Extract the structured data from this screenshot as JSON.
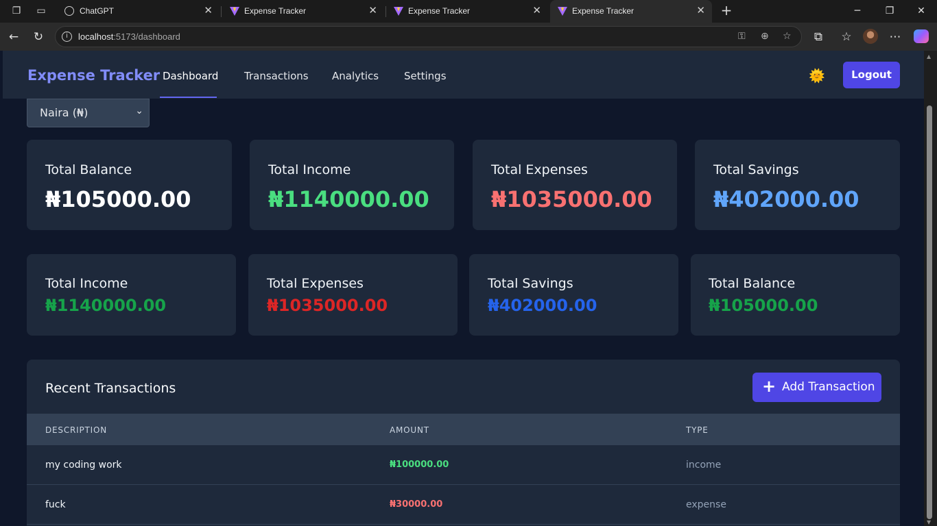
{
  "browser": {
    "tabs": [
      {
        "title": "ChatGPT",
        "icon": "chatgpt-icon"
      },
      {
        "title": "Expense Tracker",
        "icon": "vite-icon"
      },
      {
        "title": "Expense Tracker",
        "icon": "vite-icon"
      },
      {
        "title": "Expense Tracker",
        "icon": "vite-icon",
        "active": true
      }
    ],
    "address": {
      "host": "localhost",
      "rest": ":5173/dashboard"
    }
  },
  "nav": {
    "brand": "Expense Tracker",
    "links": [
      "Dashboard",
      "Transactions",
      "Analytics",
      "Settings"
    ],
    "active": "Dashboard",
    "theme_icon": "🌞",
    "logout": "Logout"
  },
  "currency": {
    "selected": "Naira (₦)"
  },
  "summary_primary": [
    {
      "label": "Total Balance",
      "amount": "₦105000.00",
      "color": "#ffffff"
    },
    {
      "label": "Total Income",
      "amount": "₦1140000.00",
      "color": "#4ade80"
    },
    {
      "label": "Total Expenses",
      "amount": "₦1035000.00",
      "color": "#f87171"
    },
    {
      "label": "Total Savings",
      "amount": "₦402000.00",
      "color": "#60a5fa"
    }
  ],
  "summary_secondary": [
    {
      "label": "Total Income",
      "amount": "₦1140000.00",
      "color": "#16a34a"
    },
    {
      "label": "Total Expenses",
      "amount": "₦1035000.00",
      "color": "#dc2626"
    },
    {
      "label": "Total Savings",
      "amount": "₦402000.00",
      "color": "#2563eb"
    },
    {
      "label": "Total Balance",
      "amount": "₦105000.00",
      "color": "#16a34a"
    }
  ],
  "transactions": {
    "title": "Recent Transactions",
    "add_button": "Add Transaction",
    "columns": [
      "DESCRIPTION",
      "AMOUNT",
      "TYPE"
    ],
    "rows": [
      {
        "description": "my coding work",
        "amount": "₦100000.00",
        "type": "income",
        "color": "#4ade80"
      },
      {
        "description": "fuck",
        "amount": "₦30000.00",
        "type": "expense",
        "color": "#f87171"
      }
    ]
  }
}
